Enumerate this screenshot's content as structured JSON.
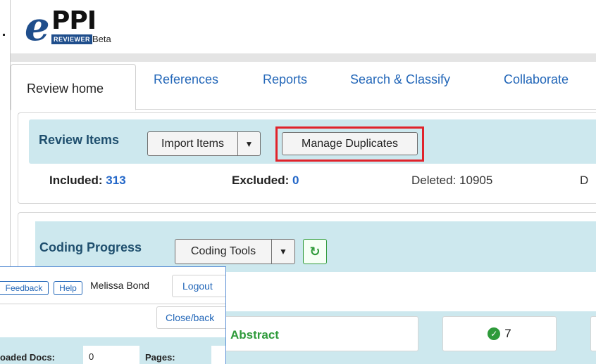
{
  "logo": {
    "e": "e",
    "ppi": "PPI",
    "reviewer": "REVIEWER",
    "beta": "Beta"
  },
  "tabs": [
    {
      "label": "Review home",
      "active": true
    },
    {
      "label": "References"
    },
    {
      "label": "Reports"
    },
    {
      "label": "Search & Classify"
    },
    {
      "label": "Collaborate"
    }
  ],
  "review_items": {
    "title": "Review Items",
    "import_label": "Import Items",
    "dropdown_glyph": "▼",
    "manage_duplicates_label": "Manage Duplicates",
    "included_label": "Included:",
    "included_value": "313",
    "excluded_label": "Excluded:",
    "excluded_value": "0",
    "deleted_text": "Deleted: 10905",
    "truncated_text": "D"
  },
  "coding_progress": {
    "title": "Coding Progress",
    "tools_label": "Coding Tools",
    "dropdown_glyph": "▼",
    "refresh_glyph": "↻",
    "abstract_label": "Abstract",
    "check_glyph": "✓",
    "count": "7"
  },
  "overlay": {
    "feedback_label": "Feedback",
    "help_label": "Help",
    "user_name": "Melissa Bond",
    "logout_label": "Logout",
    "close_back_label": "Close/back",
    "loaded_docs_label": "oaded Docs:",
    "loaded_docs_value": "0",
    "pages_label": "Pages:"
  },
  "colors": {
    "accent_blue": "#2266b8",
    "header_bg": "#cde8ee",
    "highlight_red": "#e0232b",
    "success_green": "#2e9a3a"
  }
}
